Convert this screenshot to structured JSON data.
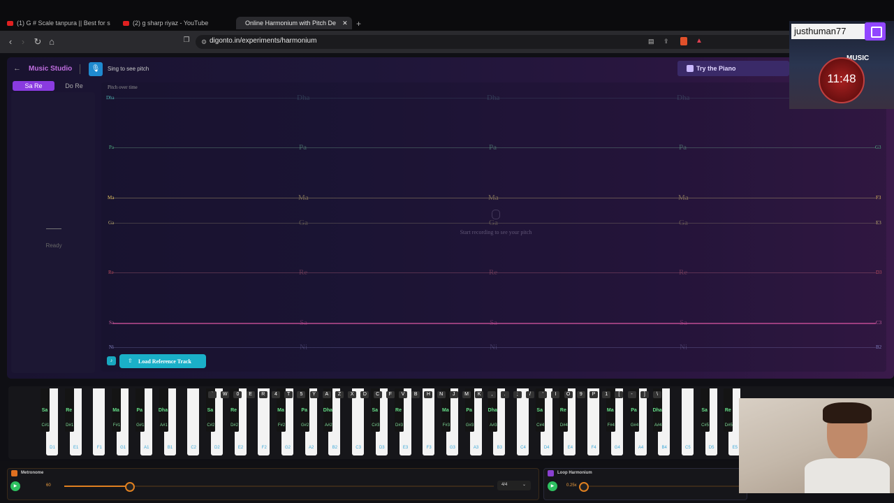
{
  "browser": {
    "tabs": [
      {
        "label": "(1) G # Scale tanpura || Best for s"
      },
      {
        "label": "(2) g sharp riyaz - YouTube"
      },
      {
        "label": "Online Harmonium with Pitch De"
      }
    ],
    "url": "digonto.in/experiments/harmonium"
  },
  "app": {
    "title": "Music Studio",
    "sing_label": "Sing to see pitch",
    "try_piano": "Try the Piano",
    "modes": [
      "Sa Re",
      "Do Re"
    ],
    "status": "Ready",
    "plot_title": "Pitch over time",
    "plot_hint": "Start recording to see your pitch",
    "load_ref": "Load Reference Track",
    "swaras": [
      {
        "name": "Dha",
        "note": ""
      },
      {
        "name": "Pa",
        "note": "G3"
      },
      {
        "name": "Ma",
        "note": "F3"
      },
      {
        "name": "Ga",
        "note": "E3"
      },
      {
        "name": "Re",
        "note": "D3"
      },
      {
        "name": "Sa",
        "note": "C3"
      },
      {
        "name": "Ni",
        "note": "B2"
      }
    ]
  },
  "keyboard": {
    "keycaps": [
      "`",
      "W",
      "0",
      "E",
      "R",
      "4",
      "T",
      "5",
      "Y",
      "A",
      "Z",
      "X",
      "D",
      "C",
      "F",
      "V",
      "B",
      "H",
      "N",
      "J",
      "M",
      "K",
      ",",
      ".",
      ";",
      "/",
      "'",
      "I",
      "O",
      "9",
      "P",
      "1",
      "[",
      "-",
      "]",
      "\\"
    ],
    "white_notes": [
      "D1",
      "E1",
      "F1",
      "G1",
      "A1",
      "B1",
      "C2",
      "D2",
      "E2",
      "F2",
      "G2",
      "A2",
      "B2",
      "C3",
      "D3",
      "E3",
      "F3",
      "G3",
      "A3",
      "B3",
      "C4",
      "D4",
      "E4",
      "F4",
      "G4",
      "A4",
      "B4",
      "C5",
      "D5",
      "E5"
    ],
    "black_notes": [
      "C#1",
      "D#1",
      "F#1",
      "G#1",
      "A#1",
      "C#2",
      "D#2",
      "F#2",
      "G#2",
      "A#2",
      "C#3",
      "D#3",
      "F#3",
      "G#3",
      "A#3",
      "C#4",
      "D#4",
      "F#4",
      "G#4",
      "A#4",
      "C#5",
      "D#5"
    ],
    "black_swaras": [
      "Sa",
      "Re",
      "Ma",
      "Pa",
      "Dha",
      "Sa",
      "Re",
      "Ma",
      "Pa",
      "Dha",
      "Sa",
      "Re",
      "Ma",
      "Pa",
      "Dha",
      "Sa",
      "Re",
      "Ma",
      "Pa",
      "Dha",
      "Sa",
      "Re"
    ]
  },
  "metronome": {
    "label": "Metronome",
    "bpm": "60",
    "time_sig": "4/4"
  },
  "loop": {
    "label": "Loop Harmonium",
    "speed": "0.25x"
  },
  "stream": {
    "username": "justhuman77",
    "timer": "11:48",
    "music": "MUSIC"
  }
}
